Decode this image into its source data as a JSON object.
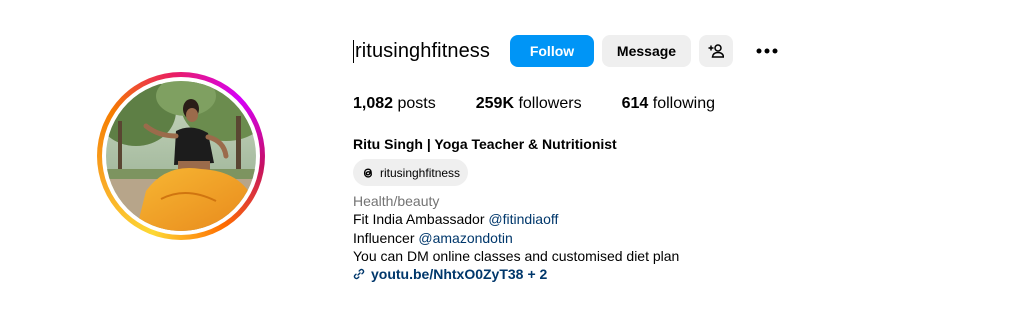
{
  "profile": {
    "username": "ritusinghfitness",
    "full_name": "Ritu Singh | Yoga Teacher & Nutritionist",
    "threads_handle": "ritusinghfitness",
    "category": "Health/beauty"
  },
  "actions": {
    "follow_label": "Follow",
    "message_label": "Message"
  },
  "stats": {
    "posts_count": "1,082",
    "posts_label": "posts",
    "followers_count": "259K",
    "followers_label": "followers",
    "following_count": "614",
    "following_label": "following"
  },
  "bio": {
    "line1_text": "Fit India Ambassador ",
    "line1_mention": "@fitindiaoff",
    "line2_text": "Influencer ",
    "line2_mention": "@amazondotin",
    "line3_text": "You can DM online classes and customised diet plan"
  },
  "link": {
    "url_text": "youtu.be/NhtxO0ZyT38",
    "more_text": "+ 2"
  },
  "colors": {
    "follow_blue": "#0095f6",
    "button_gray": "#efefef",
    "mention_blue": "#00376b",
    "category_gray": "#737373"
  },
  "icons": {
    "add_person": "add-person-icon",
    "more": "more-options-icon",
    "threads": "threads-icon",
    "link": "link-icon"
  }
}
